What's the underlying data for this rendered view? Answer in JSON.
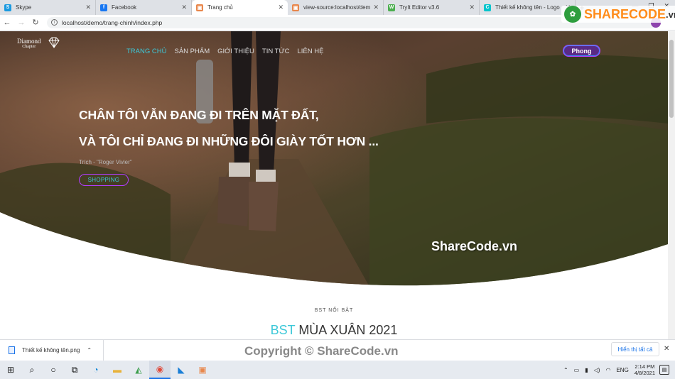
{
  "browser": {
    "tabs": [
      {
        "label": "Skype",
        "color": "#1a9ae0",
        "glyph": "S"
      },
      {
        "label": "Facebook",
        "color": "#1877f2",
        "glyph": "f"
      },
      {
        "label": "Trang chủ",
        "color": "#e8874c",
        "glyph": "▣",
        "active": true
      },
      {
        "label": "view-source:localhost/demo/",
        "color": "#e8874c",
        "glyph": "▣"
      },
      {
        "label": "TryIt Editor v3.6",
        "color": "#4caf50",
        "glyph": "W"
      },
      {
        "label": "Thiết kế không tên - Logo",
        "color": "#00c4cc",
        "glyph": "C"
      }
    ],
    "url": "localhost/demo/trang-chinh/index.php"
  },
  "site": {
    "logo_text": "Diamond",
    "logo_sub": "Chapter",
    "nav": [
      "TRANG CHỦ",
      "SẢN PHẨM",
      "GIỚI THIỆU",
      "TIN TỨC",
      "LIÊN HỆ"
    ],
    "user_label": "Phong",
    "hero": {
      "line1": "CHÂN TÔI VẪN ĐANG ĐI TRÊN MẶT ĐẤT,",
      "line2": "VÀ TÔI CHỈ ĐANG ĐI NHỮNG ĐÔI GIÀY TỐT HƠN ...",
      "quote": "Trích - \"Roger Vivier\"",
      "button": "SHOPPING"
    },
    "watermark": "ShareCode.vn",
    "section_kicker": "BST NỔI BẬT",
    "section_title_accent": "BST",
    "section_title_rest": " MÙA XUÂN 2021"
  },
  "download": {
    "filename": "Thiết kế không tên.png",
    "show_all": "Hiển thị tất cả",
    "watermark": "Copyright © ShareCode.vn"
  },
  "taskbar": {
    "lang": "ENG",
    "time": "2:14 PM",
    "date": "4/8/2021"
  },
  "sharecode": {
    "brand": "SHARECODE",
    "tld": ".vn"
  },
  "colors": {
    "accent": "#3cc8d8",
    "purple": "#b23cff"
  }
}
